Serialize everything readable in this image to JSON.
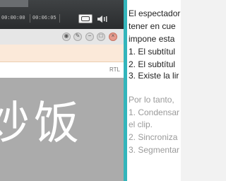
{
  "player": {
    "time_elapsed": "00:00:00",
    "time_total": "00:06:05"
  },
  "editor": {
    "direction_label": "RTL",
    "subtitle_text": "炒饭"
  },
  "document": {
    "lines": [
      "El espectador",
      "tener en cue",
      "impone esta",
      "1. El subtítul",
      "2. El subtítul",
      "3. Existe la lir"
    ],
    "lines_muted": [
      "Por lo tanto,",
      "1. Condensar",
      "el clip.",
      "2. Sincroniza",
      "3. Segmentar"
    ]
  }
}
